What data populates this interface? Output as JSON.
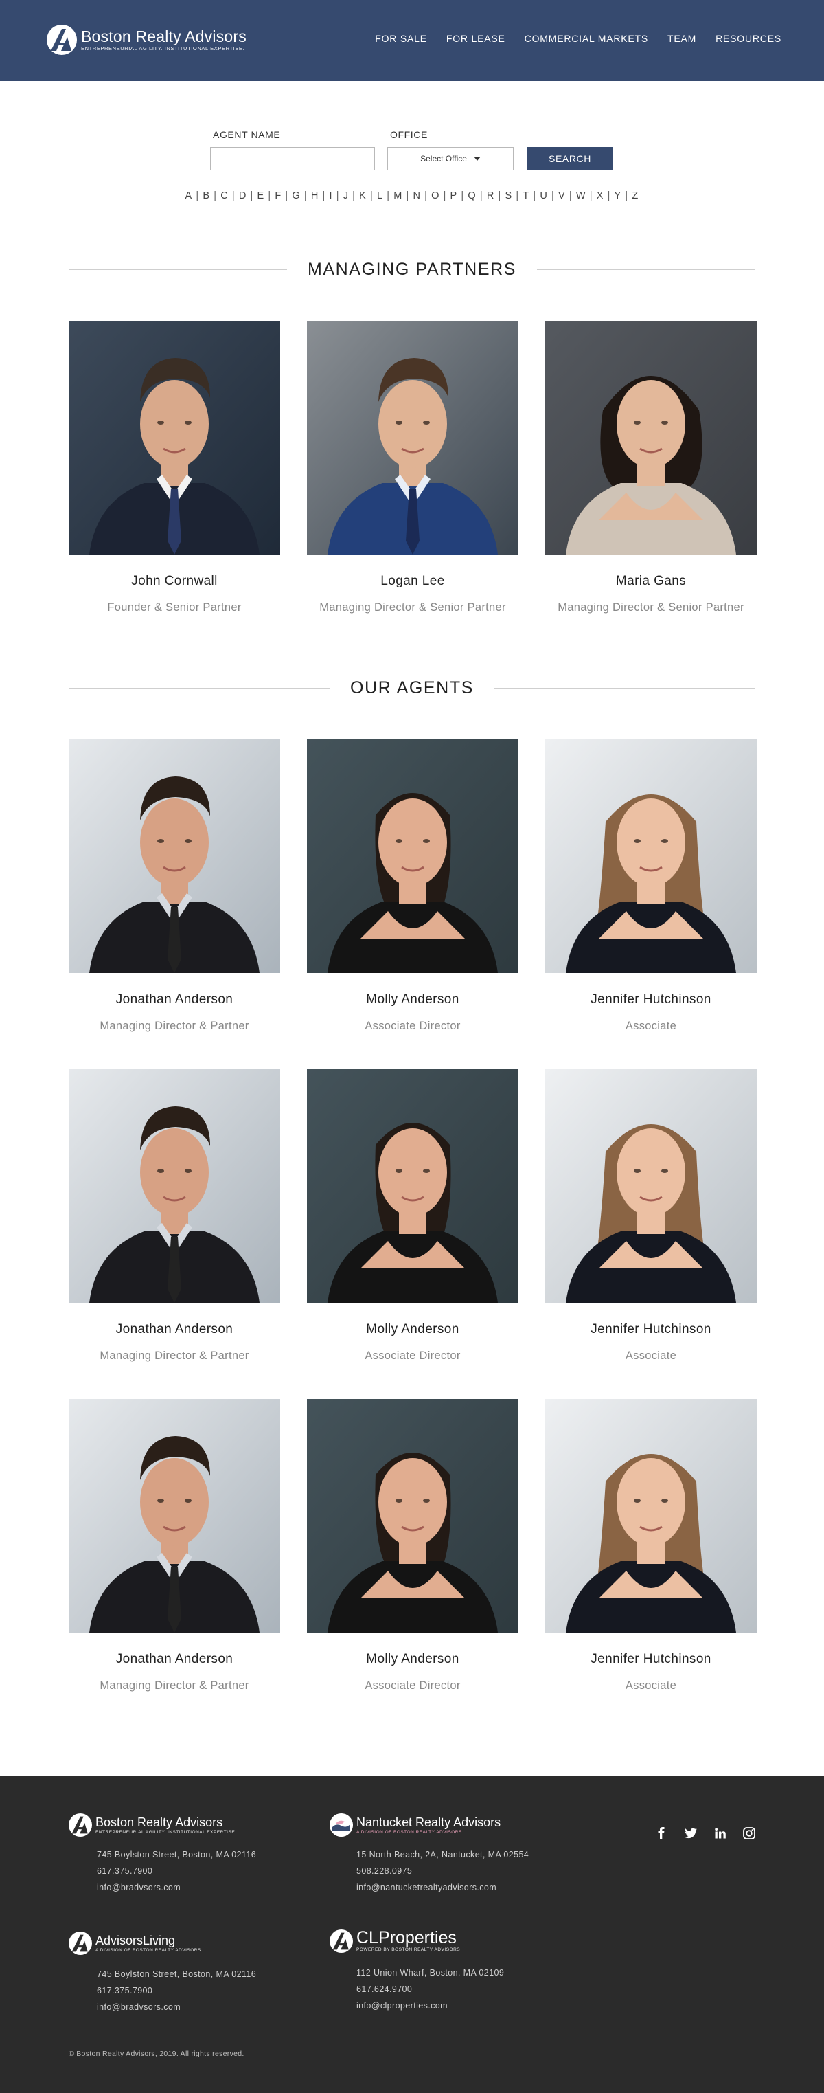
{
  "header": {
    "brand_name": "Boston Realty Advisors",
    "brand_tagline": "ENTREPRENEURIAL AGILITY. INSTITUTIONAL EXPERTISE.",
    "nav": [
      {
        "label": "FOR SALE"
      },
      {
        "label": "FOR LEASE"
      },
      {
        "label": "COMMERCIAL MARKETS"
      },
      {
        "label": "TEAM"
      },
      {
        "label": "RESOURCES"
      }
    ]
  },
  "search": {
    "agent_label": "AGENT NAME",
    "agent_value": "",
    "office_label": "OFFICE",
    "office_value": "Select Office",
    "button_label": "SEARCH",
    "letters": [
      "A",
      "B",
      "C",
      "D",
      "E",
      "F",
      "G",
      "H",
      "I",
      "J",
      "K",
      "L",
      "M",
      "N",
      "O",
      "P",
      "Q",
      "R",
      "S",
      "T",
      "U",
      "V",
      "W",
      "X",
      "Y",
      "Z"
    ],
    "separator": "|"
  },
  "partners": {
    "heading": "MANAGING PARTNERS",
    "people": [
      {
        "name": "John Cornwall",
        "title": "Founder & Senior Partner"
      },
      {
        "name": "Logan Lee",
        "title": "Managing Director & Senior Partner"
      },
      {
        "name": "Maria Gans",
        "title": "Managing Director & Senior Partner"
      }
    ]
  },
  "agents": {
    "heading": "OUR AGENTS",
    "people": [
      {
        "name": "Jonathan Anderson",
        "title": "Managing Director & Partner"
      },
      {
        "name": "Molly Anderson",
        "title": "Associate Director"
      },
      {
        "name": "Jennifer Hutchinson",
        "title": "Associate"
      },
      {
        "name": "Jonathan Anderson",
        "title": "Managing Director & Partner"
      },
      {
        "name": "Molly Anderson",
        "title": "Associate Director"
      },
      {
        "name": "Jennifer Hutchinson",
        "title": "Associate"
      },
      {
        "name": "Jonathan Anderson",
        "title": "Managing Director & Partner"
      },
      {
        "name": "Molly Anderson",
        "title": "Associate Director"
      },
      {
        "name": "Jennifer Hutchinson",
        "title": "Associate"
      }
    ]
  },
  "footer": {
    "brands": [
      {
        "name": "Boston Realty Advisors",
        "tagline": "ENTREPRENEURIAL AGILITY. INSTITUTIONAL EXPERTISE.",
        "address": "745 Boylston Street, Boston, MA 02116",
        "phone": "617.375.7900",
        "email": "info@bradvsors.com"
      },
      {
        "name": "Nantucket Realty Advisors",
        "tagline": "A DIVISION OF BOSTON REALTY ADVISORS",
        "address": "15 North Beach, 2A, Nantucket, MA 02554",
        "phone": "508.228.0975",
        "email": "info@nantucketrealtyadvisors.com"
      },
      {
        "name": "AdvisorsLiving",
        "tagline": "A DIVISION OF BOSTON REALTY ADVISORS",
        "address": "745 Boylston Street, Boston, MA 02116",
        "phone": "617.375.7900",
        "email": "info@bradvsors.com"
      },
      {
        "name": "CLProperties",
        "tagline": "POWERED BY BOSTON REALTY ADVISORS",
        "address": "112 Union Wharf, Boston, MA 02109",
        "phone": "617.624.9700",
        "email": "info@clproperties.com"
      }
    ],
    "social": [
      "facebook-icon",
      "twitter-icon",
      "linkedin-icon",
      "instagram-icon"
    ],
    "copyright": "© Boston Realty Advisors, 2019.  All rights reserved."
  },
  "colors": {
    "brand_navy": "#364a6f",
    "footer_bg": "#2b2b2b",
    "accent_pink": "#e8a0b8"
  }
}
